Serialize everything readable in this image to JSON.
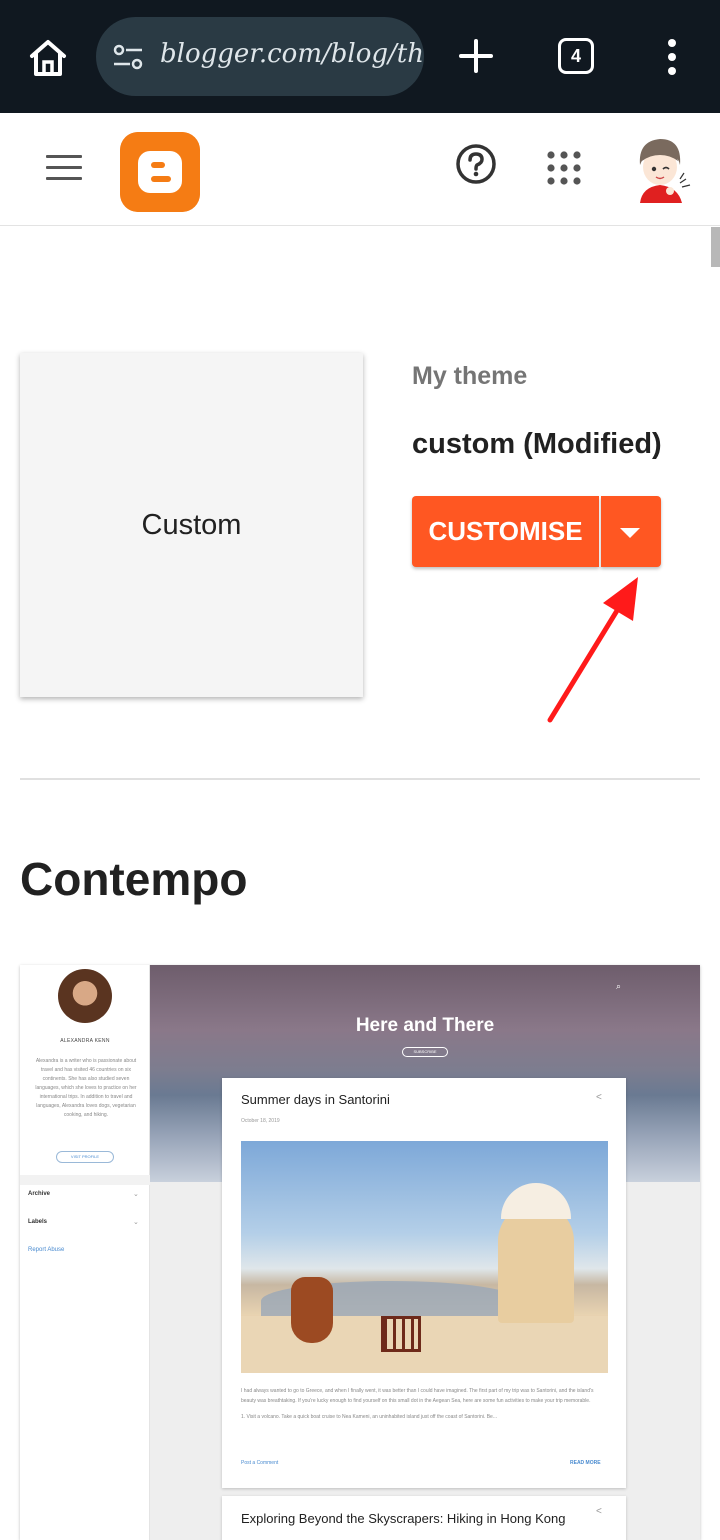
{
  "browser": {
    "url": "blogger.com/blog/the",
    "tab_count": "4"
  },
  "header": {
    "menu_icon": "hamburger-menu-icon",
    "logo_icon": "blogger-logo",
    "help_icon": "help-icon",
    "apps_icon": "apps-grid-icon",
    "avatar": "user-avatar"
  },
  "my_theme": {
    "preview_label": "Custom",
    "section_label": "My theme",
    "theme_name": "custom (Modified)",
    "customise_label": "CUSTOMISE",
    "accent_color": "#ff5722"
  },
  "annotation": {
    "arrow_color": "#ff1a1a"
  },
  "theme_gallery": {
    "section_title": "Contempo",
    "preview": {
      "author_name": "ALEXANDRA KENN",
      "author_bio": "Alexandra is a writer who is passionate about travel and has visited 46 countries on six continents. She has also studied seven languages, which she loves to practice on her international trips. In addition to travel and languages, Alexandra loves dogs, vegetarian cooking, and hiking.",
      "visit_profile": "VISIT PROFILE",
      "sidebar_links": [
        "Archive",
        "Labels"
      ],
      "report_abuse": "Report Abuse",
      "blog_title": "Here and There",
      "subscribe": "SUBSCRIBE",
      "post1": {
        "title": "Summer days in Santorini",
        "date": "October 18, 2019",
        "body": "I had always wanted to go to Greece, and when I finally went, it was better than I could have imagined. The first part of my trip was to Santorini, and the island's beauty was breathtaking. If you're lucky enough to find yourself on this small dot in the Aegean Sea, here are some fun activities to make your trip memorable.",
        "body2": "1. Visit a volcano. Take a quick boat cruise to Nea Kameni, an uninhabited island just off the coast of Santorini. Be...",
        "comment": "Post a Comment",
        "read_more": "READ MORE"
      },
      "post2": {
        "title": "Exploring Beyond the Skyscrapers: Hiking in Hong Kong"
      }
    }
  }
}
